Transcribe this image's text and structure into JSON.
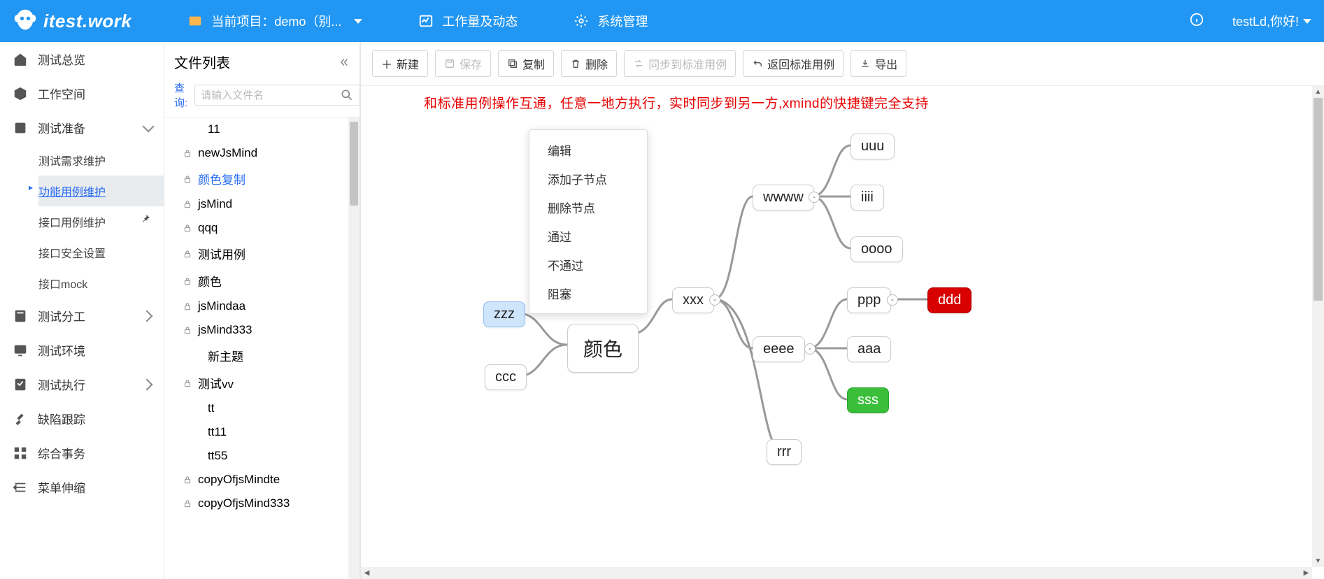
{
  "header": {
    "logo_text": "itest.work",
    "project_label": "当前项目：demo（别...",
    "workload_label": "工作量及动态",
    "admin_label": "系统管理",
    "greeting": "testLd,你好!"
  },
  "nav": {
    "items": [
      {
        "label": "测试总览",
        "type": "simple"
      },
      {
        "label": "工作空间",
        "type": "simple"
      },
      {
        "label": "测试准备",
        "type": "expand",
        "expanded": true,
        "children": [
          {
            "label": "测试需求维护"
          },
          {
            "label": "功能用例维护",
            "active": true
          },
          {
            "label": "接口用例维护",
            "pinned": true
          },
          {
            "label": "接口安全设置"
          },
          {
            "label": "接口mock"
          }
        ]
      },
      {
        "label": "测试分工",
        "type": "expand"
      },
      {
        "label": "测试环境",
        "type": "simple"
      },
      {
        "label": "测试执行",
        "type": "expand"
      },
      {
        "label": "缺陷跟踪",
        "type": "simple"
      },
      {
        "label": "综合事务",
        "type": "simple"
      },
      {
        "label": "菜单伸缩",
        "type": "simple"
      }
    ]
  },
  "filelist": {
    "title": "文件列表",
    "search_label": "查询:",
    "search_placeholder": "请输入文件名",
    "items": [
      {
        "label": "11",
        "lock": false,
        "indent": true
      },
      {
        "label": "newJsMind",
        "lock": true
      },
      {
        "label": "颜色复制",
        "lock": true,
        "active": true
      },
      {
        "label": "jsMind",
        "lock": true
      },
      {
        "label": "qqq",
        "lock": true
      },
      {
        "label": "测试用例",
        "lock": true
      },
      {
        "label": "颜色",
        "lock": true
      },
      {
        "label": "jsMindaa",
        "lock": true
      },
      {
        "label": "jsMind333",
        "lock": true
      },
      {
        "label": "新主题",
        "lock": false,
        "indent": true
      },
      {
        "label": "测试vv",
        "lock": true
      },
      {
        "label": "tt",
        "lock": false,
        "indent": true
      },
      {
        "label": "tt11",
        "lock": false,
        "indent": true
      },
      {
        "label": "tt55",
        "lock": false,
        "indent": true
      },
      {
        "label": "copyOfjsMindte",
        "lock": true
      },
      {
        "label": "copyOfjsMind333",
        "lock": true
      }
    ]
  },
  "toolbar": {
    "new": "新建",
    "save": "保存",
    "copy": "复制",
    "delete": "删除",
    "sync": "同步到标准用例",
    "back": "返回标准用例",
    "export": "导出"
  },
  "canvas": {
    "notice": "和标准用例操作互通，任意一地方执行，实时同步到另一方,xmind的快捷键完全支持",
    "context_menu": [
      "编辑",
      "添加子节点",
      "删除节点",
      "通过",
      "不通过",
      "阻塞"
    ],
    "mindmap": {
      "root": "颜色",
      "left": [
        "zzz",
        "ccc"
      ],
      "right": [
        {
          "label": "xxx",
          "children": [
            {
              "label": "wwww",
              "children": [
                {
                  "label": "uuu"
                },
                {
                  "label": "iiii"
                },
                {
                  "label": "oooo"
                }
              ]
            },
            {
              "label": "eeee",
              "children": [
                {
                  "label": "ppp",
                  "children": [
                    {
                      "label": "ddd",
                      "color": "red"
                    }
                  ]
                },
                {
                  "label": "aaa"
                },
                {
                  "label": "sss",
                  "color": "green"
                }
              ]
            },
            {
              "label": "rrr"
            }
          ]
        }
      ]
    }
  }
}
